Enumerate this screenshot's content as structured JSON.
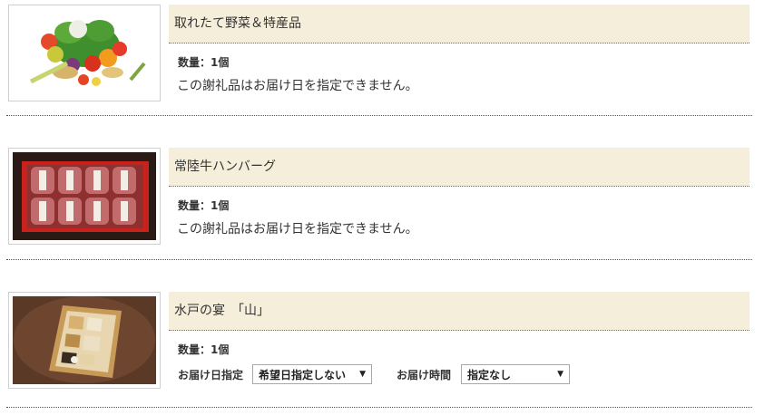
{
  "items": [
    {
      "name": "取れたて野菜＆特産品",
      "thumbnail_icon": "vegetables-photo",
      "quantity": "数量：1個",
      "note": "この謝礼品はお届け日を指定できません。"
    },
    {
      "name": "常陸牛ハンバーグ",
      "thumbnail_icon": "hamburg-steak-photo",
      "quantity": "数量：1個",
      "note": "この謝礼品はお届け日を指定できません。"
    },
    {
      "name": "水戸の宴　「山」",
      "thumbnail_icon": "gift-box-photo",
      "quantity": "数量：1個",
      "delivery_date_label": "お届け日指定",
      "delivery_date_value": "希望日指定しない",
      "delivery_time_label": "お届け時間",
      "delivery_time_value": "指定なし"
    }
  ],
  "colors": {
    "name_bar": "#f4eeda",
    "separator": "#555555"
  }
}
